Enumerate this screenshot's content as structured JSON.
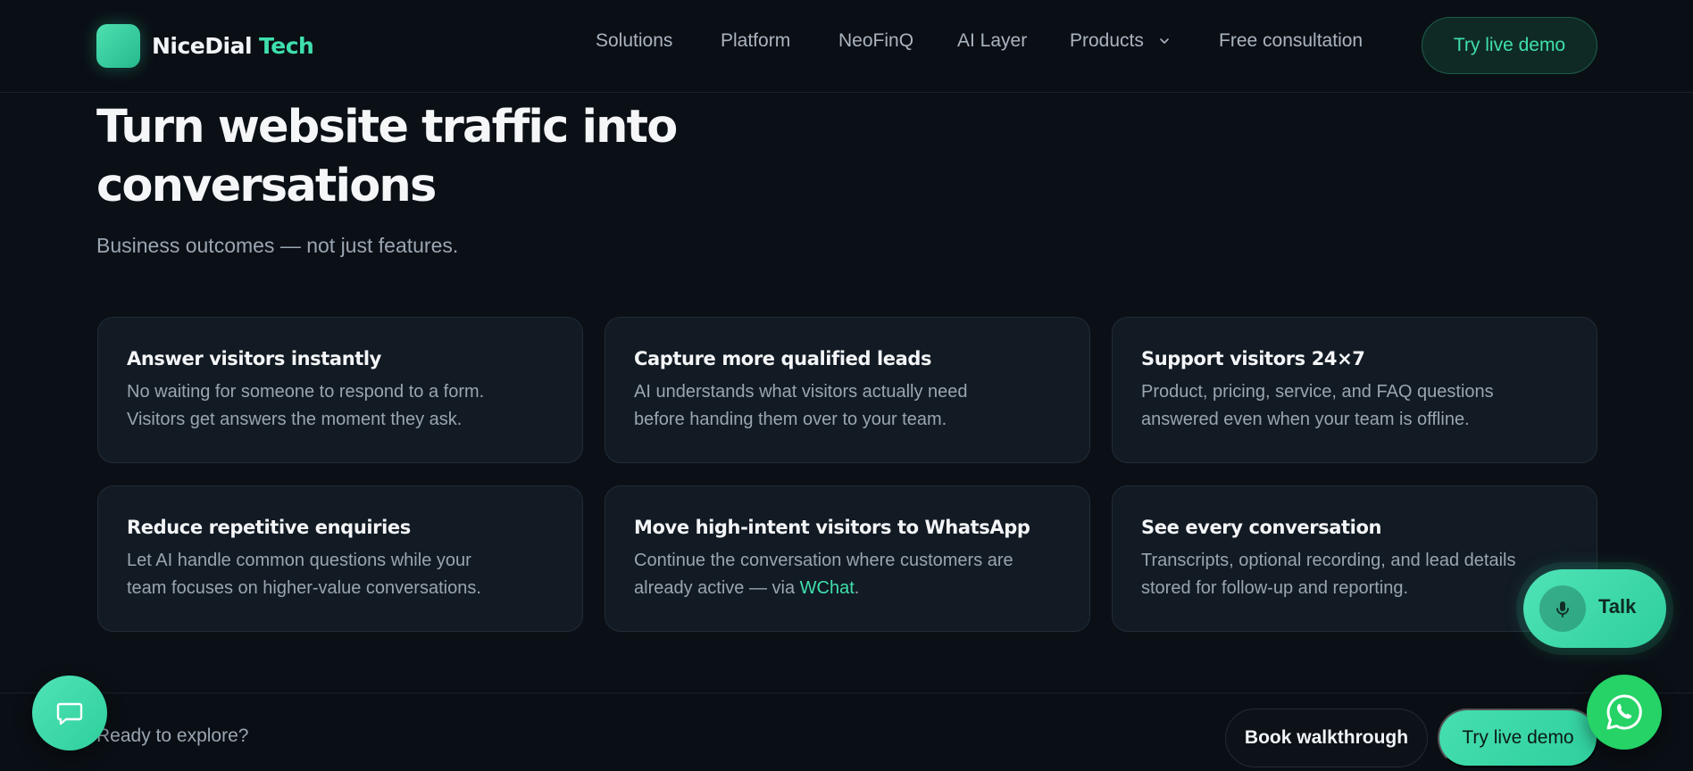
{
  "header": {
    "brand": "NiceDial",
    "brand_accent": "Tech",
    "nav": [
      {
        "label": "Solutions"
      },
      {
        "label": "Platform"
      },
      {
        "label": "NeoFinQ"
      },
      {
        "label": "AI Layer"
      },
      {
        "label": "Products"
      },
      {
        "label": "Free consultation"
      }
    ],
    "cta": "Try live demo"
  },
  "hero": {
    "title_line1": "Turn website traffic into",
    "title_line2": "conversations",
    "subtitle": "Business outcomes — not just features."
  },
  "cards": [
    {
      "title": "Answer visitors instantly",
      "line1": "No waiting for someone to respond to a form.",
      "line2": "Visitors get answers the moment they ask."
    },
    {
      "title": "Capture more qualified leads",
      "line1": "AI understands what visitors actually need",
      "line2": "before handing them over to your team."
    },
    {
      "title": "Support visitors 24×7",
      "line1": "Product, pricing, service, and FAQ questions",
      "line2": "answered even when your team is offline."
    },
    {
      "title": "Reduce repetitive enquiries",
      "line1": "Let AI handle common questions while your",
      "line2": "team focuses on higher-value conversations."
    },
    {
      "title": "Move high-intent visitors to WhatsApp",
      "line1": "Continue the conversation where customers are",
      "line2_prefix": "already active — via ",
      "link": "WChat",
      "line2_suffix": "."
    },
    {
      "title": "See every conversation",
      "line1": "Transcripts, optional recording, and lead details",
      "line2": "stored for follow-up and reporting."
    }
  ],
  "bottom": {
    "prompt": "Ready to explore?",
    "walkthrough": "Book walkthrough",
    "demo": "Try live demo"
  },
  "widgets": {
    "talk": "Talk",
    "chat_icon": "chat-bubble-icon",
    "mic_icon": "microphone-icon",
    "whatsapp_icon": "whatsapp-icon"
  },
  "colors": {
    "accent": "#3fe0ad",
    "background": "#0b1016",
    "card": "#121a23",
    "whatsapp": "#25d366"
  }
}
